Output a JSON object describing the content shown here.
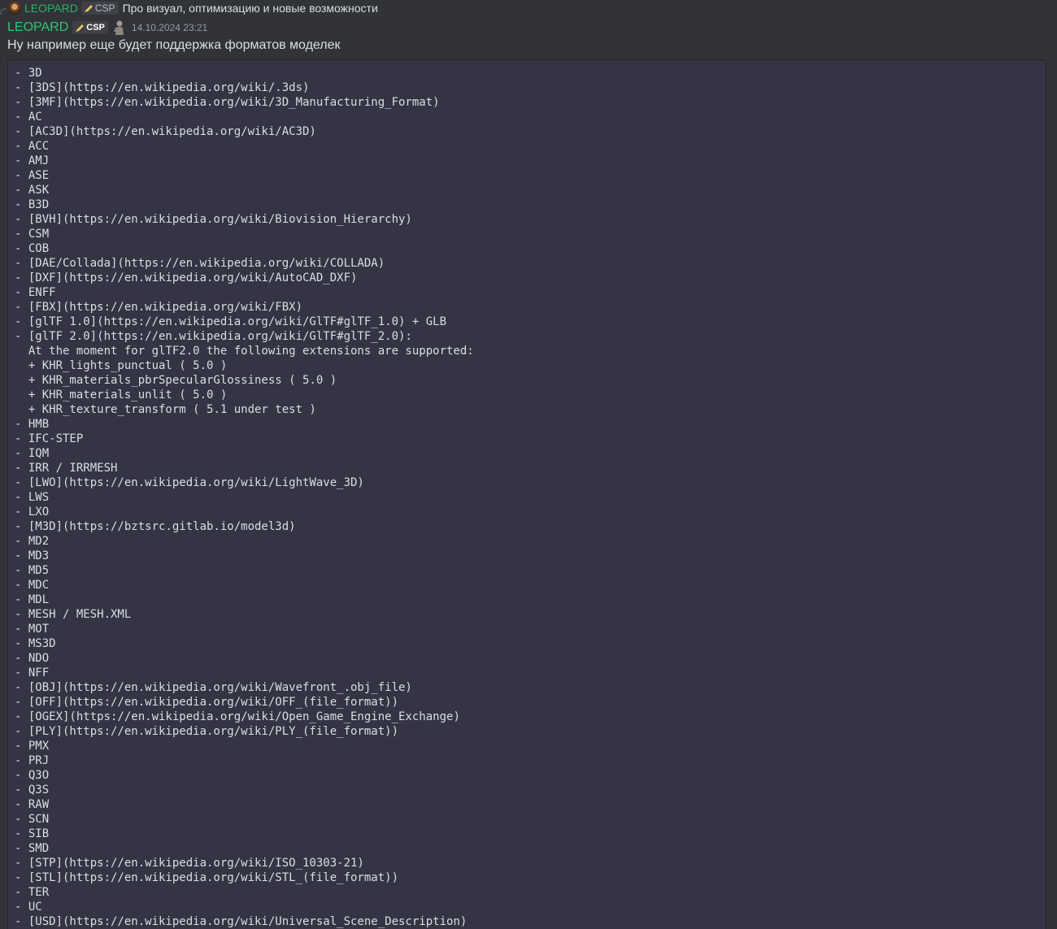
{
  "reply": {
    "author": "LEOPARD",
    "role_tag": "CSP",
    "text": "Про визуал, оптимизацию и новые возможности"
  },
  "message": {
    "author": "LEOPARD",
    "role_tag": "CSP",
    "timestamp": "14.10.2024 23:21",
    "text": "Ну например еще будет поддержка форматов моделек",
    "code_lines": [
      "- 3D",
      "- [3DS](https://en.wikipedia.org/wiki/.3ds)",
      "- [3MF](https://en.wikipedia.org/wiki/3D_Manufacturing_Format)",
      "- AC",
      "- [AC3D](https://en.wikipedia.org/wiki/AC3D)",
      "- ACC",
      "- AMJ",
      "- ASE",
      "- ASK",
      "- B3D",
      "- [BVH](https://en.wikipedia.org/wiki/Biovision_Hierarchy)",
      "- CSM",
      "- COB",
      "- [DAE/Collada](https://en.wikipedia.org/wiki/COLLADA)",
      "- [DXF](https://en.wikipedia.org/wiki/AutoCAD_DXF)",
      "- ENFF",
      "- [FBX](https://en.wikipedia.org/wiki/FBX)",
      "- [glTF 1.0](https://en.wikipedia.org/wiki/GlTF#glTF_1.0) + GLB",
      "- [glTF 2.0](https://en.wikipedia.org/wiki/GlTF#glTF_2.0):",
      "  At the moment for glTF2.0 the following extensions are supported:",
      "  + KHR_lights_punctual ( 5.0 )",
      "  + KHR_materials_pbrSpecularGlossiness ( 5.0 )",
      "  + KHR_materials_unlit ( 5.0 )",
      "  + KHR_texture_transform ( 5.1 under test )",
      "- HMB",
      "- IFC-STEP",
      "- IQM",
      "- IRR / IRRMESH",
      "- [LWO](https://en.wikipedia.org/wiki/LightWave_3D)",
      "- LWS",
      "- LXO",
      "- [M3D](https://bztsrc.gitlab.io/model3d)",
      "- MD2",
      "- MD3",
      "- MD5",
      "- MDC",
      "- MDL",
      "- MESH / MESH.XML",
      "- MOT",
      "- MS3D",
      "- NDO",
      "- NFF",
      "- [OBJ](https://en.wikipedia.org/wiki/Wavefront_.obj_file)",
      "- [OFF](https://en.wikipedia.org/wiki/OFF_(file_format))",
      "- [OGEX](https://en.wikipedia.org/wiki/Open_Game_Engine_Exchange)",
      "- [PLY](https://en.wikipedia.org/wiki/PLY_(file_format))",
      "- PMX",
      "- PRJ",
      "- Q3O",
      "- Q3S",
      "- RAW",
      "- SCN",
      "- SIB",
      "- SMD",
      "- [STP](https://en.wikipedia.org/wiki/ISO_10303-21)",
      "- [STL](https://en.wikipedia.org/wiki/STL_(file_format))",
      "- TER",
      "- UC",
      "- [USD](https://en.wikipedia.org/wiki/Universal_Scene_Description)"
    ]
  },
  "colors": {
    "background": "#313338",
    "author_name": "#2dc770",
    "timestamp": "#949ba4",
    "code_background": "#343444"
  },
  "icons": {
    "reply_avatar": "avatar-icon",
    "role_tag": "pen-icon",
    "status": "character-icon"
  }
}
